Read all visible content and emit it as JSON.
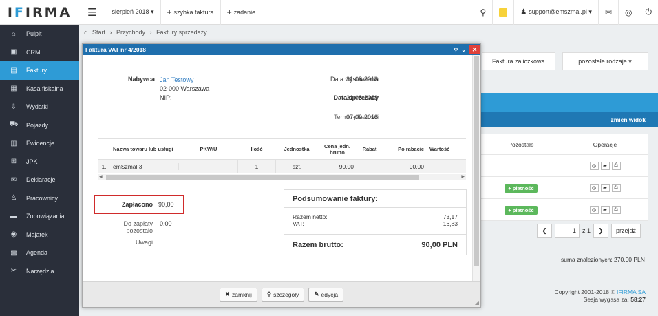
{
  "app": {
    "logo_prefix": "I",
    "logo_accent": "F",
    "logo_suffix": "IRMA"
  },
  "sidebar": {
    "items": [
      {
        "label": "Pulpit",
        "icon": "dashboard-icon",
        "glyph": "⌂"
      },
      {
        "label": "CRM",
        "icon": "crm-icon",
        "glyph": "▣"
      },
      {
        "label": "Faktury",
        "icon": "invoice-icon",
        "glyph": "▤"
      },
      {
        "label": "Kasa fiskalna",
        "icon": "cash-register-icon",
        "glyph": "▦"
      },
      {
        "label": "Wydatki",
        "icon": "expenses-icon",
        "glyph": "⇩"
      },
      {
        "label": "Pojazdy",
        "icon": "vehicle-icon",
        "glyph": "⛟"
      },
      {
        "label": "Ewidencje",
        "icon": "records-icon",
        "glyph": "▥"
      },
      {
        "label": "JPK",
        "icon": "jpk-icon",
        "glyph": "⊞"
      },
      {
        "label": "Deklaracje",
        "icon": "declarations-icon",
        "glyph": "✉"
      },
      {
        "label": "Pracownicy",
        "icon": "employees-icon",
        "glyph": "♙"
      },
      {
        "label": "Zobowiązania",
        "icon": "liabilities-icon",
        "glyph": "▬"
      },
      {
        "label": "Majątek",
        "icon": "assets-icon",
        "glyph": "◉"
      },
      {
        "label": "Agenda",
        "icon": "agenda-icon",
        "glyph": "▩"
      },
      {
        "label": "Narzędzia",
        "icon": "tools-icon",
        "glyph": "✂"
      }
    ]
  },
  "topbar": {
    "month_label": "sierpień 2018 ▾",
    "quick_invoice_label": "szybka faktura",
    "task_label": "zadanie",
    "user_label": "support@emszmal.pl ▾"
  },
  "breadcrumb": {
    "home": "Start",
    "sep": "›",
    "revenue": "Przychody",
    "current": "Faktury sprzedaży"
  },
  "background": {
    "tab_advance": "Faktura zaliczkowa",
    "tab_other": "pozostałe rodzaje ▾",
    "change_view": "zmień widok",
    "col_other": "Pozostałe",
    "col_ops": "Operacje",
    "pay_label": "+ płatność",
    "pager_current": "1",
    "pager_total": "z 1",
    "pager_go": "przejdź",
    "found_sum_label": "suma znalezionych:",
    "found_sum_value": "270,00 PLN",
    "copyright_prefix": "Copyright 2001-2018 ©",
    "copyright_brand": "IFIRMA SA",
    "session_label": "Sesja wygasa za:",
    "session_value": "58:27"
  },
  "modal": {
    "title": "Faktura VAT nr 4/2018",
    "buyer_label": "Nabywca",
    "buyer_name": "Jan Testowy",
    "buyer_city": "02-000 Warszawa",
    "buyer_nip": "NIP:",
    "issue_date_label": "Data wystawienia",
    "issue_date": "31-08-2018",
    "sale_date_label": "Data sprzedaży",
    "sale_date": "31-08-2018",
    "due_label": "Termin płatności",
    "due_date": "07-09-2018",
    "table": {
      "headers": [
        "",
        "Nazwa towaru lub usługi",
        "PKWiU",
        "Ilość",
        "Jednostka",
        "Cena jedn. brutto",
        "Rabat",
        "Po rabacie",
        "Wartość"
      ],
      "rows": [
        [
          "1.",
          "emSzmal 3",
          "",
          "1",
          "szt.",
          "90,00",
          "",
          "90,00",
          ""
        ]
      ]
    },
    "paid_label": "Zapłacono",
    "paid_value": "90,00",
    "remaining_label": "Do zapłaty pozostało",
    "remaining_value": "0,00",
    "notes_label": "Uwagi",
    "summary_title": "Podsumowanie faktury:",
    "net_label": "Razem netto:",
    "net_value": "73,17",
    "vat_label": "VAT:",
    "vat_value": "16,83",
    "gross_label": "Razem brutto:",
    "gross_value": "90,00 PLN",
    "btn_close": "zamknij",
    "btn_details": "szczegóły",
    "btn_edit": "edycja"
  }
}
